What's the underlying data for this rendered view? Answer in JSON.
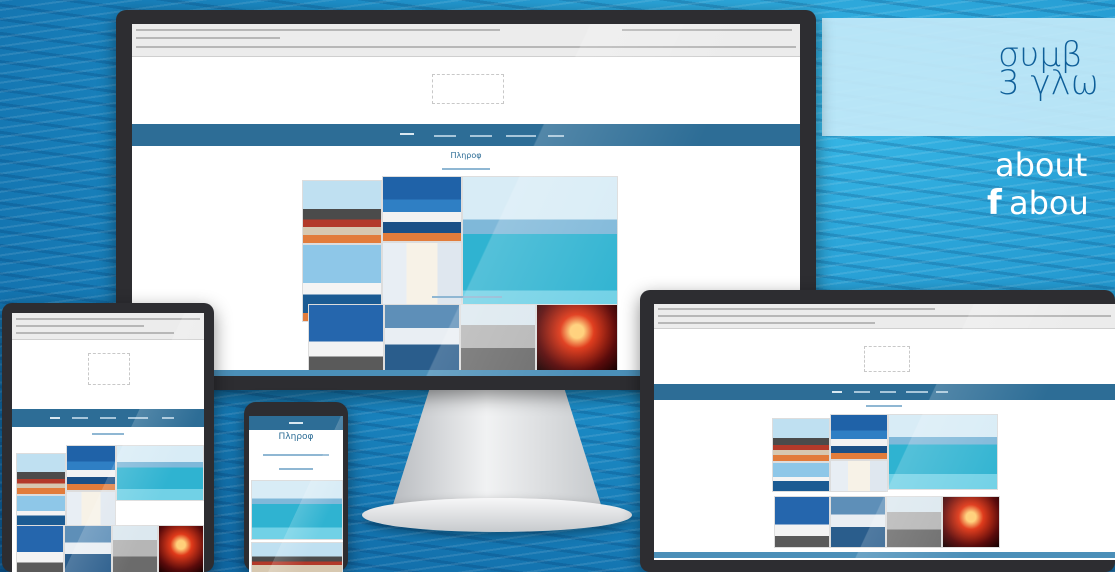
{
  "headline": {
    "line1": "συμβ",
    "line2": "3 γλω"
  },
  "links": {
    "site": "about",
    "facebook_icon": "f",
    "facebook": "abou"
  },
  "site": {
    "section_title_main": "Πληροφ",
    "section_title_phone": "Πληροφ"
  },
  "colors": {
    "nav": "#2d6d96",
    "caption": "#e27c3b",
    "banner_text": "#0f5f99"
  }
}
